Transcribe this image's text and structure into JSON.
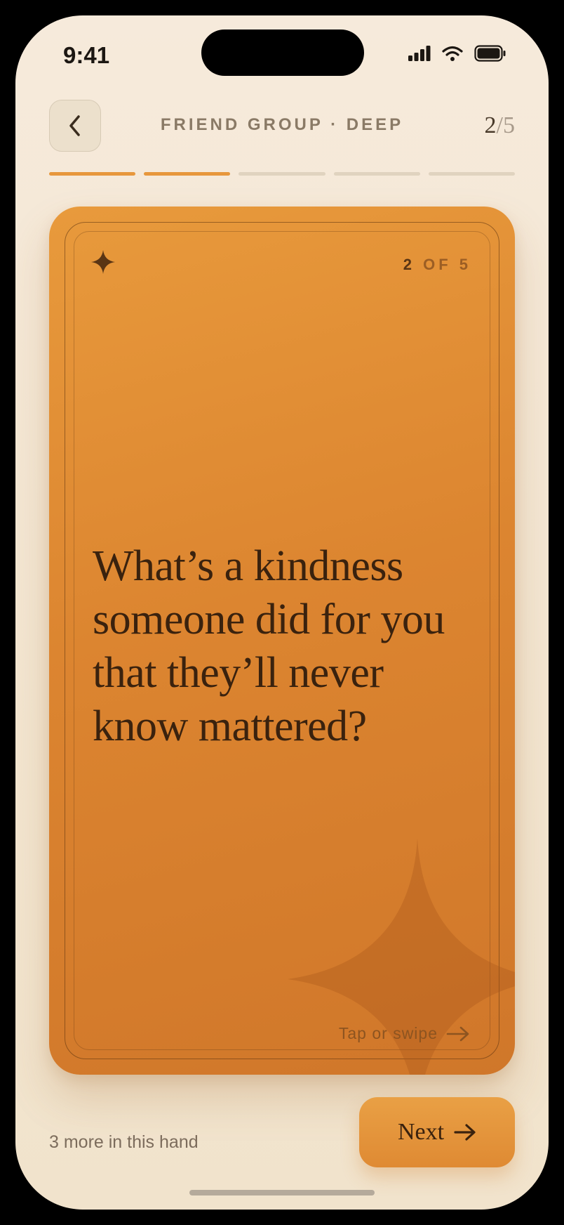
{
  "status_bar": {
    "time": "9:41"
  },
  "header": {
    "deck_title": "FRIEND GROUP · DEEP",
    "counter_current": "2",
    "counter_total": "5",
    "progress": {
      "total": 5,
      "completed": 2
    }
  },
  "card": {
    "count_current": "2",
    "count_rest": "OF 5",
    "question": "What’s a kindness someone did for you that they’ll never know mattered?",
    "hint": "Tap or swipe"
  },
  "footer": {
    "remaining_text": "3 more in this hand",
    "next_label": "Next"
  },
  "colors": {
    "accent": "#e7973c",
    "card_top": "#e89a3c",
    "card_bottom": "#d0772a",
    "background": "#f4e7d3",
    "ink": "#3a220e"
  },
  "icons": {
    "back": "chevron-left-icon",
    "card_corner": "four-point-star-icon",
    "hint": "arrow-right-icon",
    "next": "arrow-right-icon"
  }
}
